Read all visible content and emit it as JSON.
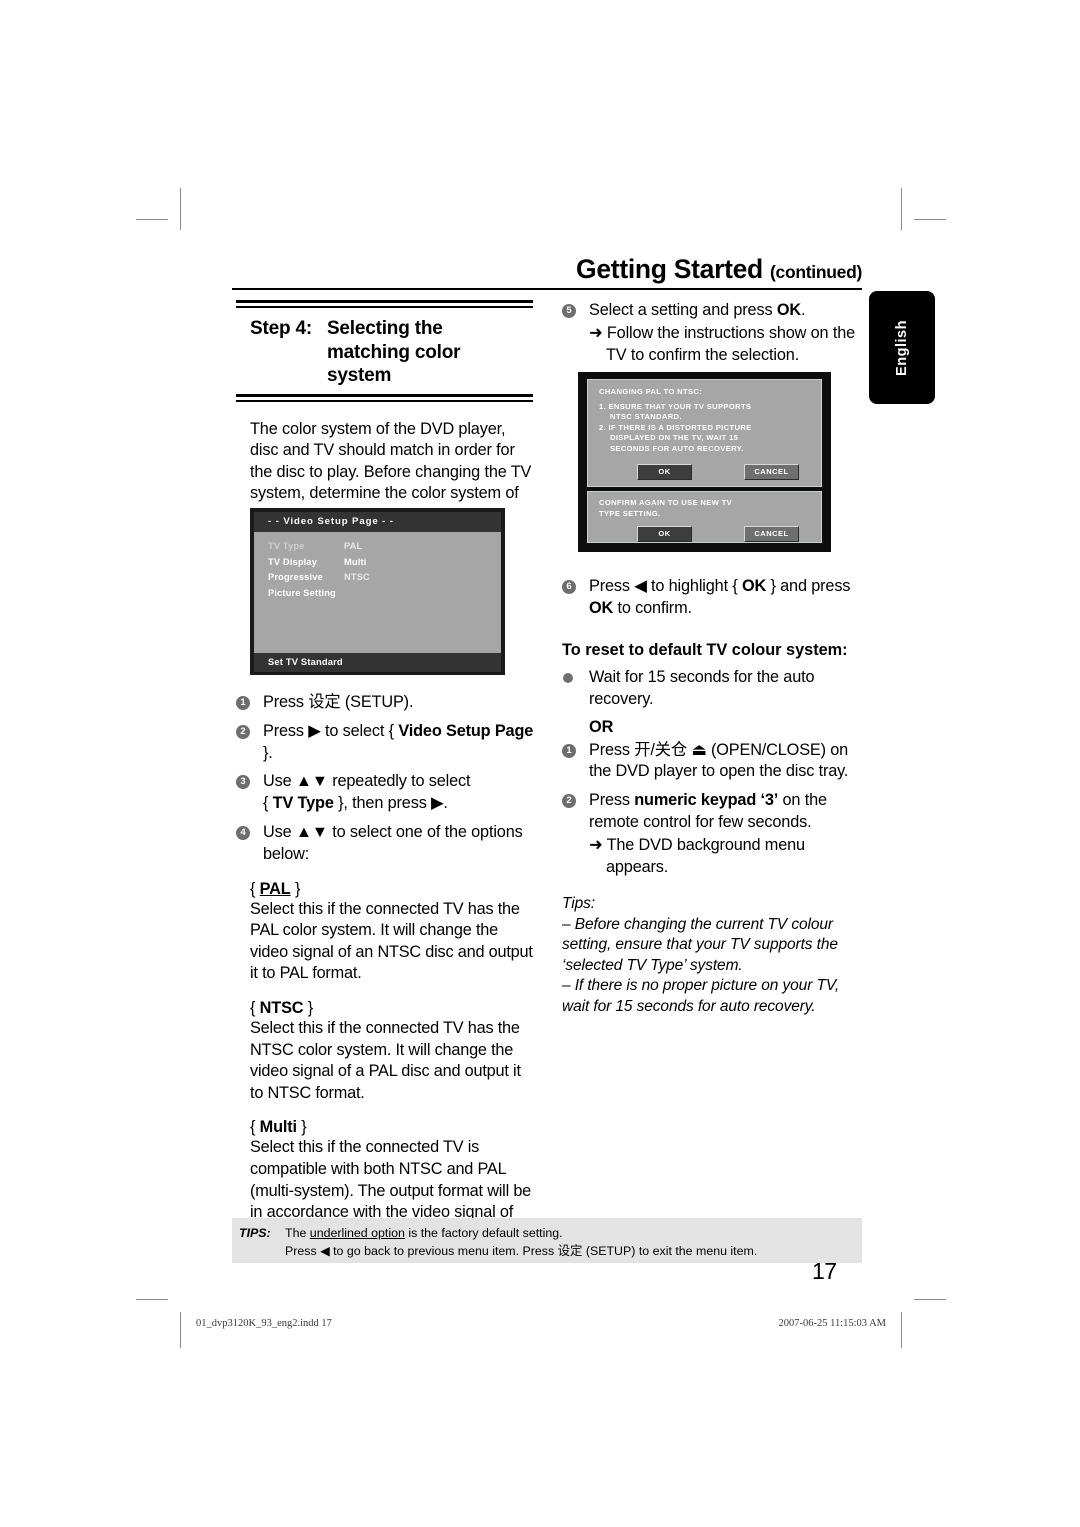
{
  "header": {
    "title": "Getting Started",
    "continued": "(continued)"
  },
  "language_tab": {
    "label": "English"
  },
  "left_column": {
    "step_label": "Step 4:",
    "step_title_lines": [
      "Selecting the",
      "matching color",
      "system"
    ],
    "intro": "The color system of the DVD player, disc and TV should match in order for the disc to play. Before changing the TV system, determine the color system of your TV.",
    "tv_osd": {
      "title": "- -  Video Setup Page   - -",
      "rows": [
        {
          "key": "TV Type",
          "value": "PAL"
        },
        {
          "key": "TV Display",
          "value": "Multi"
        },
        {
          "key": "Progressive",
          "value": "NTSC"
        },
        {
          "key": "Picture Setting",
          "value": ""
        }
      ],
      "footer": "Set TV Standard"
    },
    "steps": [
      {
        "num": "1",
        "text_pre": "Press 设定 (SETUP).",
        "text_bold": "",
        "text_post": ""
      },
      {
        "num": "2",
        "text_pre": "Press ",
        "arrow": "▶",
        "mid": " to select { ",
        "text_bold": "Video Setup Page",
        "text_post": " }."
      },
      {
        "num": "3",
        "line1_pre": "Use ",
        "arrows": "▲▼",
        "line1_post": " repeatedly to select",
        "line2_pre": "{ ",
        "line2_bold": "TV Type",
        "line2_post": " }, then press ▶."
      },
      {
        "num": "4",
        "line1_pre": "Use ",
        "arrows": "▲▼",
        "line1_post": " to select one of the options",
        "line2": "below:"
      }
    ],
    "options": [
      {
        "name": "PAL",
        "underlined": true,
        "description": "Select this if the connected TV has the PAL color system. It will change the video signal of an NTSC disc and output it to PAL format."
      },
      {
        "name": "NTSC",
        "underlined": false,
        "description": "Select this if the connected TV has the NTSC color system. It will change the video signal of a PAL disc and output it to NTSC format."
      },
      {
        "name": "Multi",
        "underlined": false,
        "description": "Select this if the connected TV is compatible with both NTSC and PAL (multi-system). The output format will be in accordance with the video signal of the disc."
      }
    ]
  },
  "right_column": {
    "step5": {
      "num": "5",
      "text_pre": "Select a setting and press ",
      "text_bold": "OK",
      "text_post": ".",
      "sub": "➜ Follow the instructions show on the TV to confirm the selection."
    },
    "tv_dialogs": [
      {
        "title": "CHANGING PAL TO NTSC:",
        "lines": [
          "1. ENSURE THAT YOUR TV SUPPORTS",
          "NTSC STANDARD.",
          "2. IF THERE IS A DISTORTED PICTURE",
          "DISPLAYED ON THE TV, WAIT 15",
          "SECONDS FOR AUTO RECOVERY."
        ],
        "ok": "OK",
        "cancel": "CANCEL"
      },
      {
        "title": "CONFIRM AGAIN TO USE NEW TV",
        "lines": [
          "TYPE SETTING."
        ],
        "ok": "OK",
        "cancel": "CANCEL"
      }
    ],
    "step6": {
      "num": "6",
      "text_pre": "Press ",
      "arrow": "◀",
      "mid": " to highlight { ",
      "text_bold": "OK",
      "text_post": " } and press ",
      "text_bold2": "OK",
      "text_end": " to confirm."
    },
    "reset_heading": "To reset to default TV colour system:",
    "reset_bullet": "Wait for 15 seconds for the auto recovery.",
    "or": "OR",
    "reset_steps": [
      {
        "num": "1",
        "text": "Press 开/关仓 ⏏ (OPEN/CLOSE) on the DVD player to open the disc tray."
      },
      {
        "num": "2",
        "text_pre": "Press ",
        "text_bold": "numeric keypad ‘3’",
        "text_post": " on the remote control for few seconds.",
        "sub": "➜ The DVD background menu appears."
      }
    ],
    "tips_label": "Tips:",
    "tips": [
      "– Before changing the current TV colour setting, ensure that your TV supports the ‘selected TV Type’ system.",
      "– If there is no proper picture on your TV, wait for 15 seconds for auto recovery."
    ]
  },
  "footer": {
    "tips_label": "TIPS:",
    "line1_pre": "The ",
    "line1_underlined": "underlined option",
    "line1_post": " is the factory default setting.",
    "line2": "Press ◀ to go back to previous menu item. Press 设定 (SETUP) to exit the menu item.",
    "page_number": "17"
  },
  "slug": {
    "file": "01_dvp3120K_93_eng2.indd   17",
    "timestamp": "2007-06-25   11:15:03 AM"
  }
}
